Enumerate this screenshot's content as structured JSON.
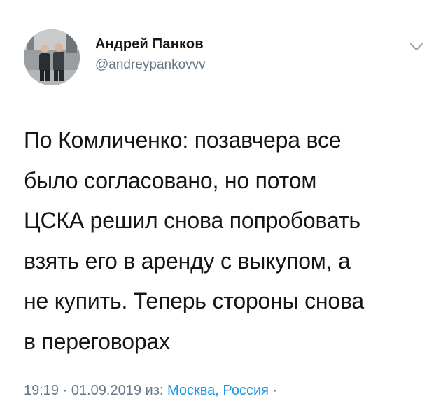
{
  "author": {
    "display_name": "Андрей Панков",
    "handle": "@andreypankovvv"
  },
  "tweet": {
    "lines": [
      "По Комличенко: позавчера все",
      "было согласовано, но потом",
      "ЦСКА решил снова попробовать",
      "взять его в аренду с выкупом, а",
      "не купить. Теперь стороны снова",
      "в переговорах"
    ]
  },
  "meta": {
    "time": "19:19",
    "separator": "·",
    "date": "01.09.2019",
    "from_label": "из:",
    "location": "Москва, Россия",
    "trailing_separator": "·"
  },
  "icons": {
    "menu": "chevron-down-icon"
  },
  "colors": {
    "text": "#14171a",
    "secondary": "#657786",
    "link": "#1b95e0"
  }
}
